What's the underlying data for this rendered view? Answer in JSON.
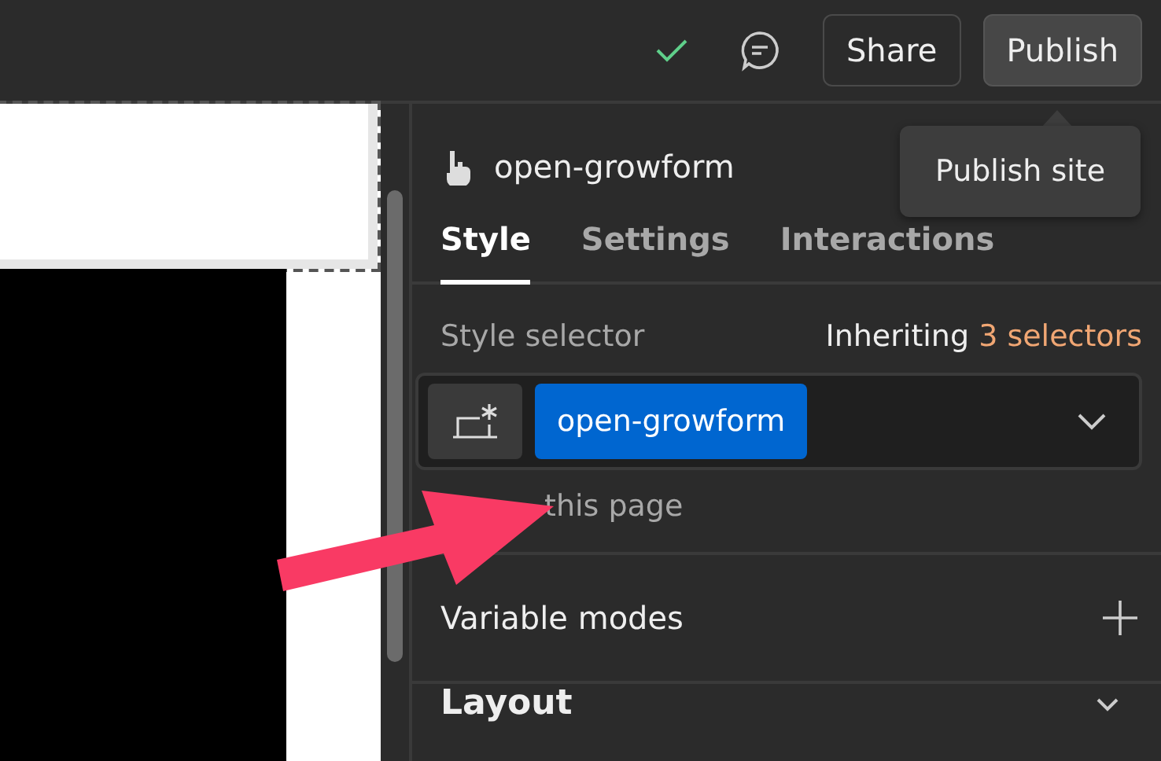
{
  "topbar": {
    "saved": true,
    "buttons": [
      {
        "label": "Share",
        "kind": "outline"
      },
      {
        "label": "Publish",
        "kind": "filled"
      }
    ],
    "tooltip": "Publish site"
  },
  "panel": {
    "element": "open-growform",
    "tabs": [
      {
        "label": "Style",
        "selected": true
      },
      {
        "label": "Settings",
        "selected": false
      },
      {
        "label": "Interactions",
        "selected": false
      }
    ],
    "selector": {
      "label": "Style selector",
      "inheriting": "Inheriting **3 selectors**",
      "tag": "open-growform",
      "note": "this page"
    },
    "sections": [
      {
        "label": "Variable modes",
        "kind": "add"
      },
      {
        "label": "Layout",
        "kind": "collapse"
      }
    ]
  }
}
